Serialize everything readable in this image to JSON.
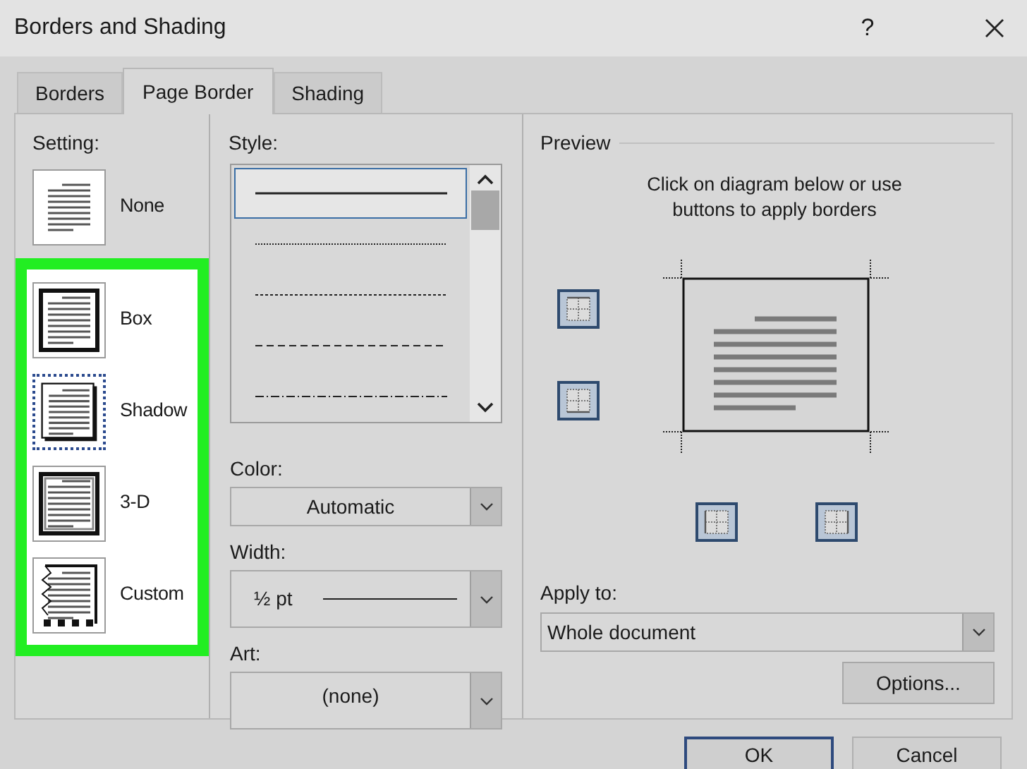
{
  "window": {
    "title": "Borders and Shading",
    "help": "?"
  },
  "tabs": [
    {
      "label": "Borders",
      "selected": false
    },
    {
      "label": "Page Border",
      "selected": true
    },
    {
      "label": "Shading",
      "selected": false
    }
  ],
  "setting": {
    "label": "Setting:",
    "options": [
      {
        "label": "None",
        "kind": "none",
        "selected": false,
        "highlighted": false
      },
      {
        "label": "Box",
        "kind": "box",
        "selected": false,
        "highlighted": true
      },
      {
        "label": "Shadow",
        "kind": "shadow",
        "selected": true,
        "highlighted": true
      },
      {
        "label": "3-D",
        "kind": "threed",
        "selected": false,
        "highlighted": true
      },
      {
        "label": "Custom",
        "kind": "custom",
        "selected": false,
        "highlighted": true
      }
    ]
  },
  "style": {
    "label": "Style:",
    "items": [
      {
        "kind": "solid",
        "selected": true
      },
      {
        "kind": "dotted",
        "selected": false
      },
      {
        "kind": "fine-dashed",
        "selected": false
      },
      {
        "kind": "dashed",
        "selected": false
      },
      {
        "kind": "dash-dot",
        "selected": false
      }
    ]
  },
  "color": {
    "label": "Color:",
    "value": "Automatic"
  },
  "width": {
    "label": "Width:",
    "value": "½ pt"
  },
  "art": {
    "label": "Art:",
    "value": "(none)"
  },
  "preview": {
    "label": "Preview",
    "hint": "Click on diagram below or use buttons to apply borders",
    "side_buttons": [
      {
        "kind": "top"
      },
      {
        "kind": "bottom"
      }
    ],
    "bottom_buttons": [
      {
        "kind": "left"
      },
      {
        "kind": "right"
      }
    ]
  },
  "apply_to": {
    "label": "Apply to:",
    "value": "Whole document"
  },
  "options_button": "Options...",
  "footer_buttons": [
    "OK",
    "Cancel"
  ]
}
